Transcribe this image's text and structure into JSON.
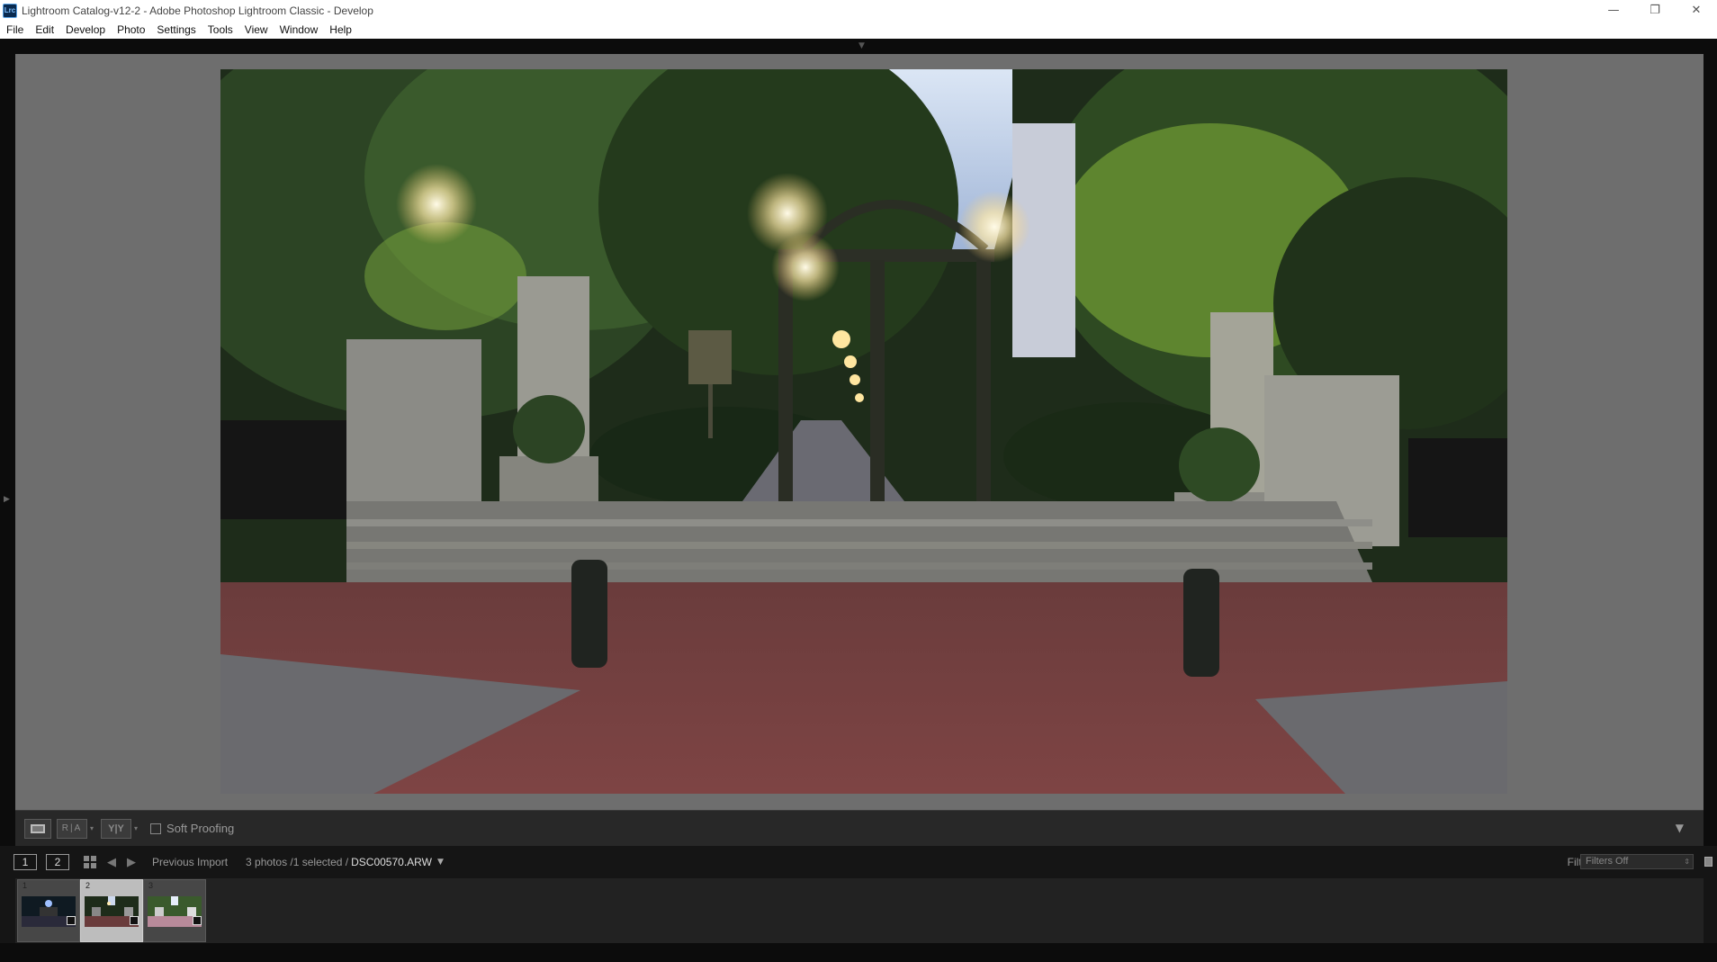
{
  "window": {
    "app_icon_text": "Lrc",
    "title": "Lightroom Catalog-v12-2 - Adobe Photoshop Lightroom Classic - Develop",
    "controls": [
      "minimize-icon",
      "restore-icon",
      "close-icon"
    ]
  },
  "menu": {
    "items": [
      {
        "label": "File"
      },
      {
        "label": "Edit"
      },
      {
        "label": "Develop"
      },
      {
        "label": "Photo"
      },
      {
        "label": "Settings"
      },
      {
        "label": "Tools"
      },
      {
        "label": "View"
      },
      {
        "label": "Window"
      },
      {
        "label": "Help"
      }
    ]
  },
  "toolbar": {
    "compare_label": "R|A",
    "survey_label": "Y|Y",
    "soft_proofing_label": "Soft Proofing",
    "soft_proofing_checked": false
  },
  "filmstrip_header": {
    "screen_1": "1",
    "screen_2": "2",
    "source": "Previous Import",
    "count_text": "3 photos /1 selected /",
    "filename": "DSC00570.ARW",
    "filter_label": "Filter :",
    "filter_value": "Filters Off"
  },
  "filmstrip": {
    "thumbnails": [
      {
        "index": "1",
        "selected": false
      },
      {
        "index": "2",
        "selected": true
      },
      {
        "index": "3",
        "selected": false
      }
    ]
  },
  "colors": {
    "panel_bg": "#6e6e6e",
    "chrome_dark": "#151515"
  }
}
